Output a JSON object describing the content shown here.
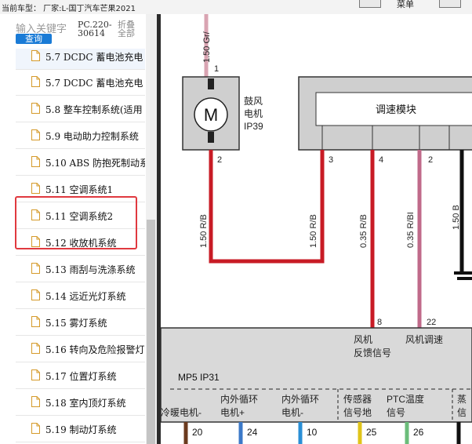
{
  "topbar": {
    "current_car": "当前车型：   厂家:L-国丁汽车芒果2021",
    "btn_label": "菜单"
  },
  "sidebar": {
    "search_placeholder": "输入关键字",
    "search_button": "查询",
    "code": [
      "PC.220-",
      "30614"
    ],
    "fold": [
      "折叠",
      "全部"
    ],
    "items": [
      {
        "label": "5.7 DCDC 蓄电池充电"
      },
      {
        "label": "5.7 DCDC 蓄电池充电"
      },
      {
        "label": "5.8 整车控制系统(适用"
      },
      {
        "label": "5.9 电动助力控制系统"
      },
      {
        "label": "5.10 ABS 防抱死制动系"
      },
      {
        "label": "5.11 空调系统1"
      },
      {
        "label": "5.11 空调系统2"
      },
      {
        "label": "5.12 收放机系统"
      },
      {
        "label": "5.13 雨刮与洗涤系统"
      },
      {
        "label": "5.14 远近光灯系统"
      },
      {
        "label": "5.15 雾灯系统"
      },
      {
        "label": "5.16 转向及危险报警灯"
      },
      {
        "label": "5.17 位置灯系统"
      },
      {
        "label": "5.18 室内顶灯系统"
      },
      {
        "label": "5.19 制动灯系统"
      }
    ]
  },
  "diagram": {
    "top_wire": "1.50 Gr/",
    "blower_pin1": "1",
    "motor_symbol": "M",
    "blower_label": [
      "鼓风",
      "电机",
      "IP39"
    ],
    "blower_pin2": "2",
    "module_label": "调速模块",
    "module_pins": [
      "3",
      "4",
      "2"
    ],
    "wire_labels": [
      "1.50 R/B",
      "1.50 R/B",
      "0.35 R/B",
      "0.35 R/BI",
      "1.50 B"
    ],
    "connector_pins": [
      "8",
      "22"
    ],
    "signal_labels": [
      [
        "风机",
        "反馈信号"
      ],
      [
        "风机调速"
      ]
    ],
    "mp5": "MP5 IP31",
    "bottom_labels": [
      [
        "冷暖电机-"
      ],
      [
        "内外循环",
        "电机+"
      ],
      [
        "内外循环",
        "电机-"
      ],
      [
        "传感器",
        "信号地"
      ],
      [
        "PTC温度",
        "信号"
      ],
      [
        "蒸",
        "信"
      ]
    ],
    "bottom_pins": [
      "20",
      "24",
      "10",
      "25",
      "26"
    ]
  }
}
